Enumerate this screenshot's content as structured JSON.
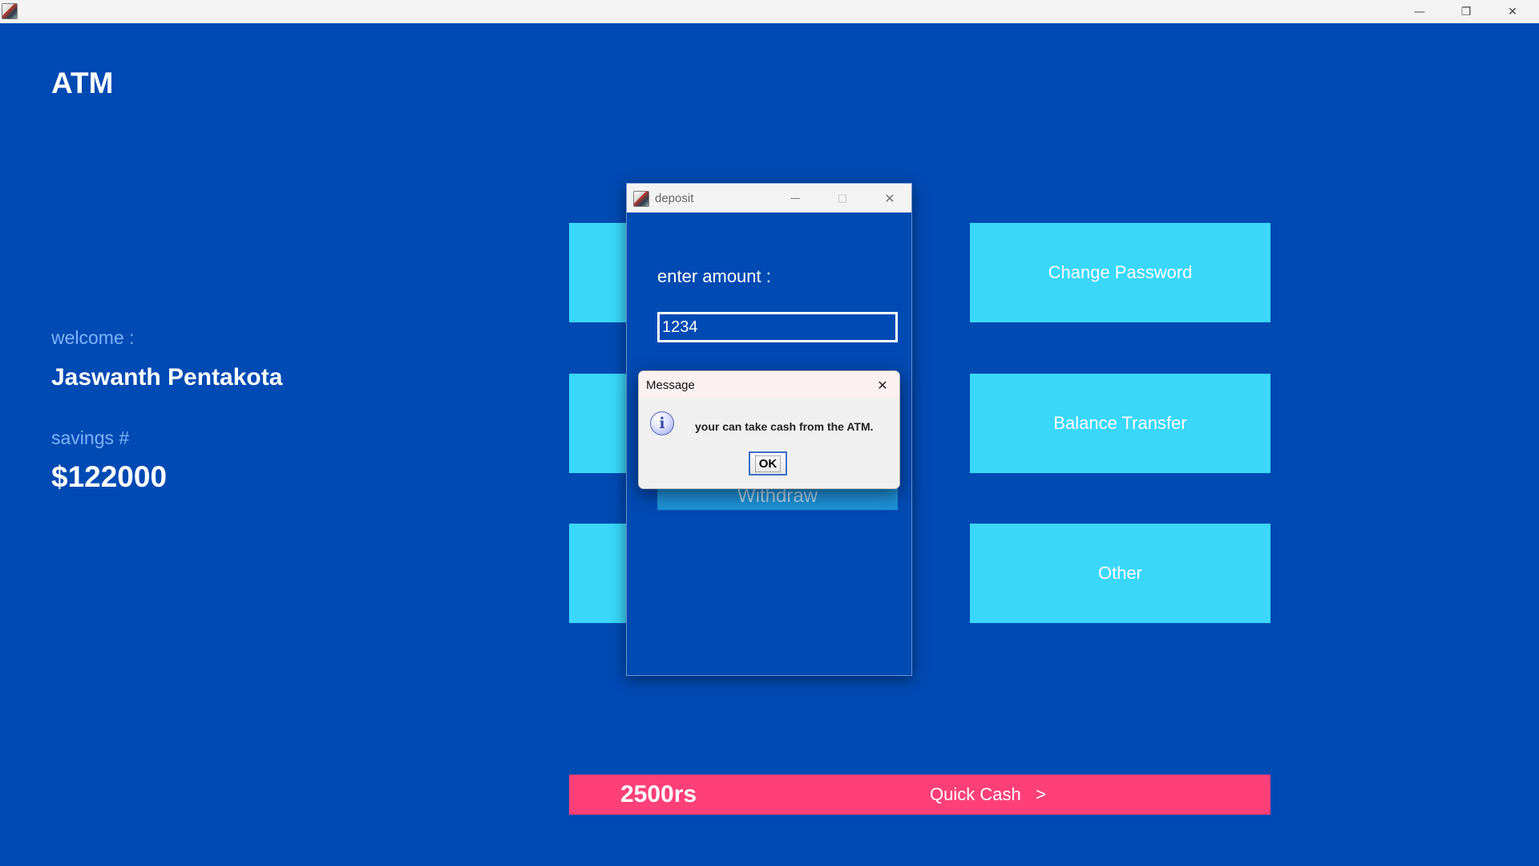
{
  "main_window": {
    "bank_title": "ATM",
    "welcome_label": "welcome :",
    "user_name": "Jaswanth Pentakota",
    "savings_label": "savings #",
    "balance": "$122000",
    "menu": {
      "change_password": "Change Password",
      "balance_transfer": "Balance Transfer",
      "other": "Other"
    },
    "quick_cash": {
      "amount": "2500rs",
      "label": "Quick Cash   >"
    }
  },
  "deposit_window": {
    "title": "deposit",
    "amount_label": "enter amount :",
    "amount_value": "1234",
    "withdraw_label": "Withdraw"
  },
  "message_dialog": {
    "title": "Message",
    "text": "your can take cash from the ATM.",
    "ok_label": "OK",
    "icon": "info-icon"
  },
  "colors": {
    "background": "#004ab3",
    "menu_button": "#3ad7fb",
    "quick_cash_bar": "#ff3f78",
    "label_muted": "#7fb3ff"
  }
}
